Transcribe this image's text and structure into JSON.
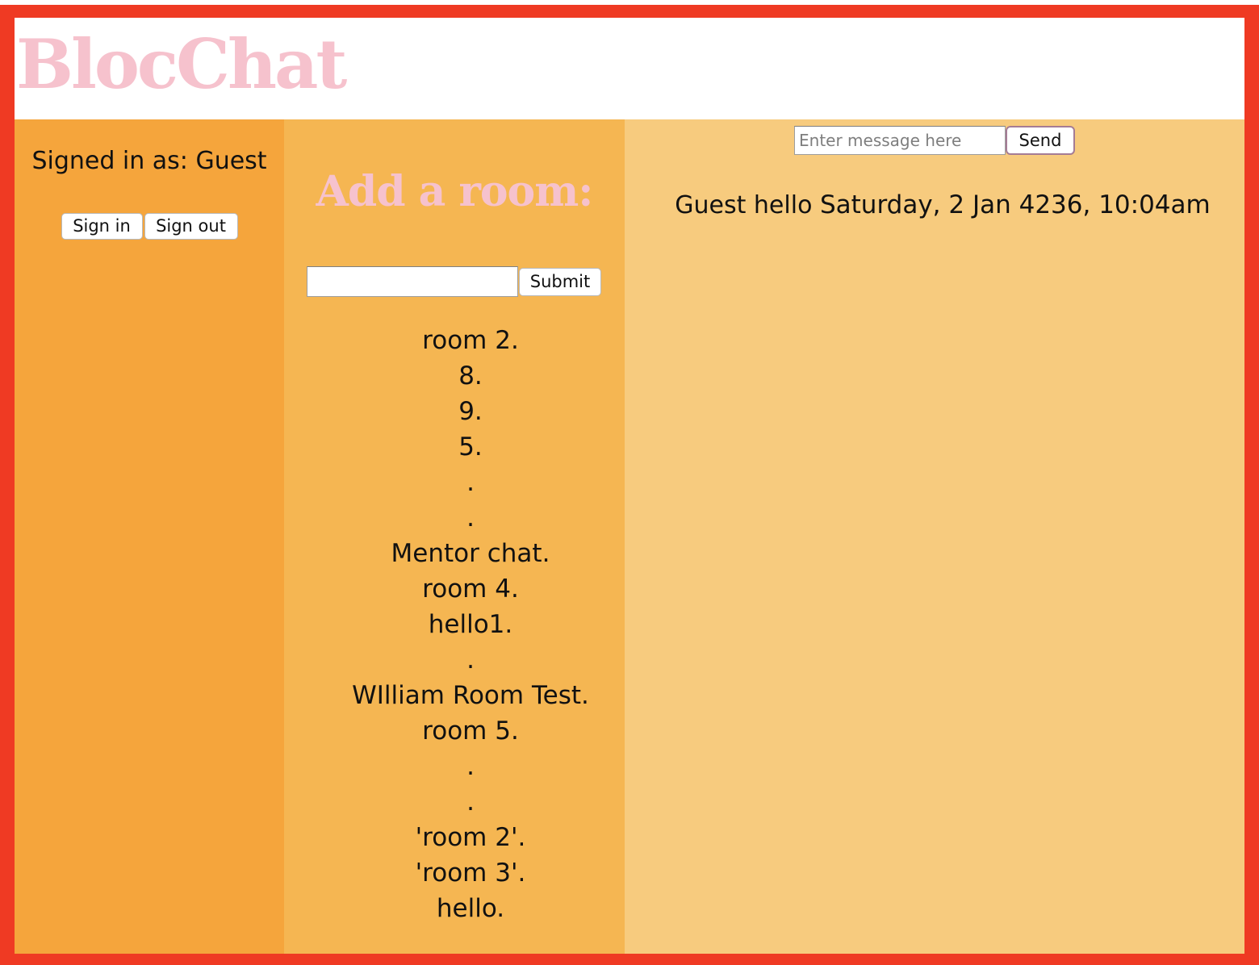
{
  "app": {
    "title": "BlocChat"
  },
  "user_panel": {
    "signed_in_text": "Signed in as: Guest",
    "sign_in_label": "Sign in",
    "sign_out_label": "Sign out"
  },
  "rooms_panel": {
    "title": "Add a room:",
    "room_name_value": "",
    "submit_label": "Submit",
    "rooms": [
      "room 2.",
      "8.",
      "9.",
      "5.",
      ".",
      ".",
      "Mentor chat.",
      "room 4.",
      "hello1.",
      ".",
      "WIlliam Room Test.",
      "room 5.",
      ".",
      ".",
      "'room 2'.",
      "'room 3'.",
      "hello."
    ]
  },
  "chat_panel": {
    "message_placeholder": "Enter message here",
    "send_label": "Send",
    "messages": [
      {
        "username": "Guest",
        "content": "hello",
        "sent_at": "Saturday, 2 Jan 4236, 10:04am"
      }
    ]
  },
  "colors": {
    "frame_border": "#ef3a23",
    "brand_pink": "#f6c2cd",
    "user_panel_bg": "#f5a53c",
    "rooms_panel_bg": "#f5b652",
    "chat_panel_bg": "#f7cb7e"
  }
}
